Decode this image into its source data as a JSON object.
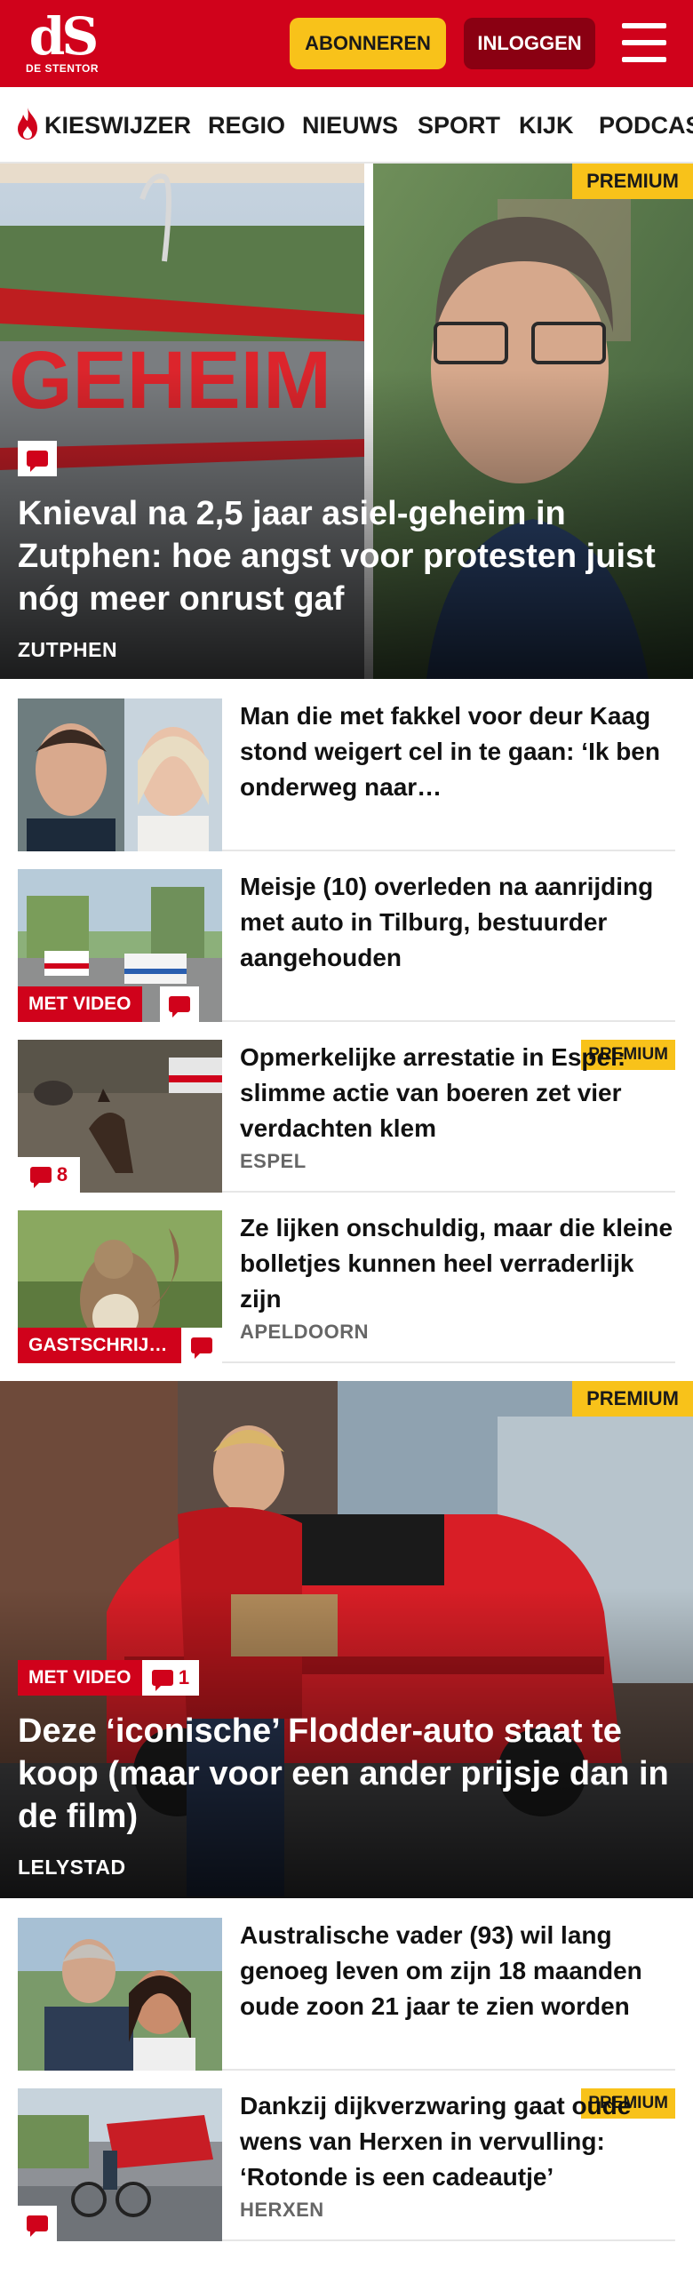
{
  "header": {
    "logo_mark": "dS",
    "logo_sub": "DE STENTOR",
    "subscribe_label": "ABONNEREN",
    "login_label": "INLOGGEN",
    "menu_icon": "hamburger-icon",
    "brand_color": "#d0021b",
    "accent_color": "#f8c21a"
  },
  "nav": {
    "items": [
      {
        "label": "KIESWIJZER",
        "icon": "flame-icon"
      },
      {
        "label": "REGIO"
      },
      {
        "label": "NIEUWS"
      },
      {
        "label": "SPORT"
      },
      {
        "label": "KIJK"
      },
      {
        "label": "PODCAS"
      }
    ]
  },
  "hero1": {
    "premium": "PREMIUM",
    "title": "Knieval na 2,5 jaar asiel-geheim in Zutphen: hoe angst voor protesten juist nóg meer onrust gaf",
    "location": "ZUTPHEN",
    "image_text": "GEHEIM"
  },
  "articles1": [
    {
      "title": "Man die met fakkel voor deur Kaag stond weigert cel in te gaan: ‘Ik ben onderweg naar…",
      "location": ""
    },
    {
      "title": "Meisje (10) overleden na aanrijding met auto in Tilburg, bestuurder aangehouden",
      "location": "",
      "label": "MET VIDEO"
    },
    {
      "title": "Opmerkelijke arrestatie in Espel: slimme actie van boeren zet vier verdachten klem",
      "location": "ESPEL",
      "premium": "PREMIUM",
      "comments": "8"
    },
    {
      "title": "Ze lijken onschuldig, maar die kleine bolletjes kunnen heel verraderlijk zijn",
      "location": "APELDOORN",
      "label": "GASTSCHRIJ…"
    }
  ],
  "hero2": {
    "premium": "PREMIUM",
    "label": "MET VIDEO",
    "comments": "1",
    "title": "Deze ‘iconische’ Flodder-auto staat te koop (maar voor een ander prijsje dan in de film)",
    "location": "LELYSTAD"
  },
  "articles2": [
    {
      "title": "Australische vader (93) wil lang genoeg leven om zijn 18 maanden oude zoon 21 jaar te zien worden",
      "location": ""
    },
    {
      "title": "Dankzij dijkverzwaring gaat oude wens van Herxen in vervulling: ‘Rotonde is een cadeautje’",
      "location": "HERXEN",
      "premium": "PREMIUM"
    }
  ]
}
